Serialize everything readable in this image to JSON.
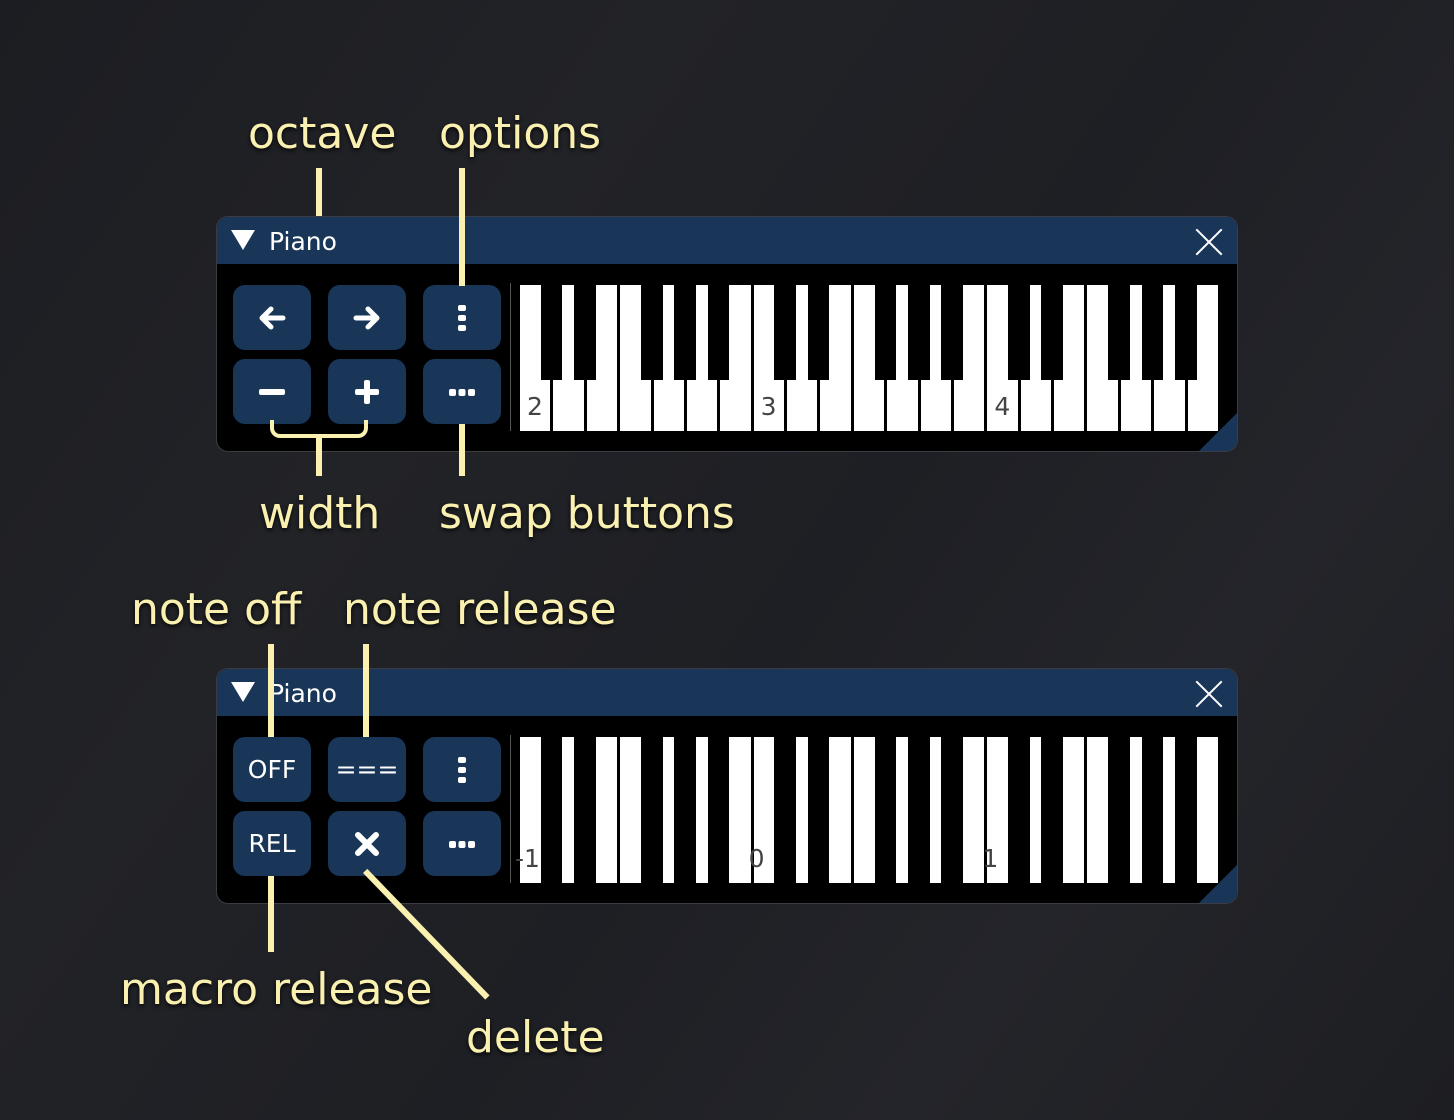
{
  "annotations": {
    "octave": "octave",
    "options": "options",
    "width": "width",
    "swap_buttons": "swap buttons",
    "note_off": "note off",
    "note_release": "note release",
    "macro_release": "macro release",
    "delete": "delete"
  },
  "colors": {
    "annotation": "#faf0b0",
    "titlebar": "#193659",
    "button": "#193659"
  },
  "window_top": {
    "title": "Piano",
    "buttons": [
      {
        "name": "octave-down",
        "icon": "arrow-left-icon",
        "label": "←"
      },
      {
        "name": "octave-up",
        "icon": "arrow-right-icon",
        "label": "→"
      },
      {
        "name": "options",
        "icon": "options-icon",
        "label": "⋮"
      },
      {
        "name": "width-decrease",
        "icon": "minus-icon",
        "label": "−"
      },
      {
        "name": "width-increase",
        "icon": "plus-icon",
        "label": "+"
      },
      {
        "name": "swap-buttons",
        "icon": "more-horizontal-icon",
        "label": "•••"
      }
    ],
    "keyboard": {
      "octaves": [
        2,
        3,
        4
      ],
      "octave_labels": [
        "2",
        "3",
        "4"
      ],
      "style": "normal"
    }
  },
  "window_bottom": {
    "title": "Piano",
    "buttons": [
      {
        "name": "note-off",
        "icon": "",
        "label": "OFF"
      },
      {
        "name": "note-release",
        "icon": "",
        "label": "==="
      },
      {
        "name": "options",
        "icon": "options-icon",
        "label": "⋮"
      },
      {
        "name": "macro-release",
        "icon": "",
        "label": "REL"
      },
      {
        "name": "delete",
        "icon": "x-icon",
        "label": "✖"
      },
      {
        "name": "swap-buttons",
        "icon": "more-horizontal-icon",
        "label": "•••"
      }
    ],
    "keyboard": {
      "octaves": [
        -1,
        0,
        1
      ],
      "octave_labels": [
        "-1",
        "0",
        "1"
      ],
      "style": "full-black"
    }
  }
}
